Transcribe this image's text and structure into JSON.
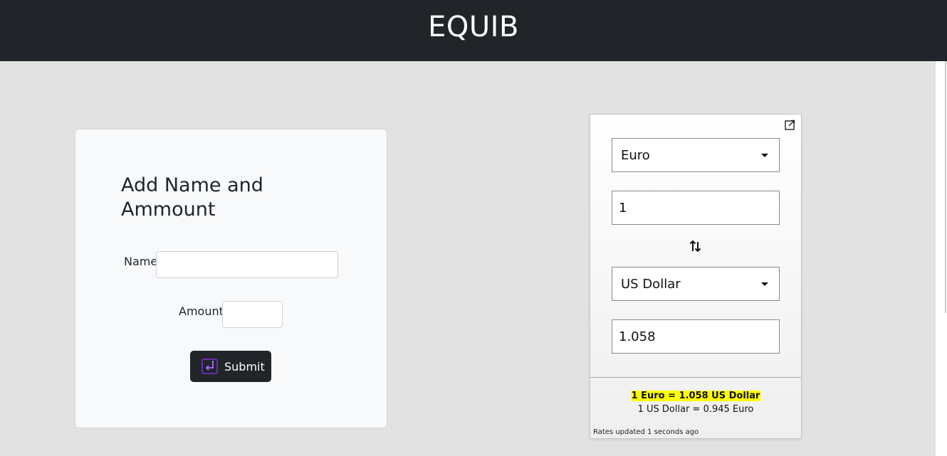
{
  "header": {
    "title": "EQUIB"
  },
  "form": {
    "title": "Add Name and Ammount",
    "name_label": "Name",
    "name_value": "",
    "amount_label": "Amount",
    "amount_value": "",
    "submit_label": "Submit"
  },
  "converter": {
    "from_currency": "Euro",
    "from_amount": "1",
    "to_currency": "US Dollar",
    "to_amount": "1.058",
    "rate_text": "1 Euro = 1.058 US Dollar",
    "inverse_rate_text": "1 US Dollar = 0.945 Euro",
    "updated_text": "Rates updated 1 seconds ago",
    "highlight_color": "#ffff00"
  },
  "colors": {
    "header_bg": "#212529",
    "page_bg": "#e2e2e2",
    "card_bg": "#f8f9fa",
    "button_bg": "#212529",
    "button_icon_accent": "#8a2be2"
  },
  "icons": {
    "submit": "enter-return-icon",
    "external": "external-link-icon",
    "swap": "swap-arrows-icon",
    "dropdown": "caret-down-icon"
  }
}
